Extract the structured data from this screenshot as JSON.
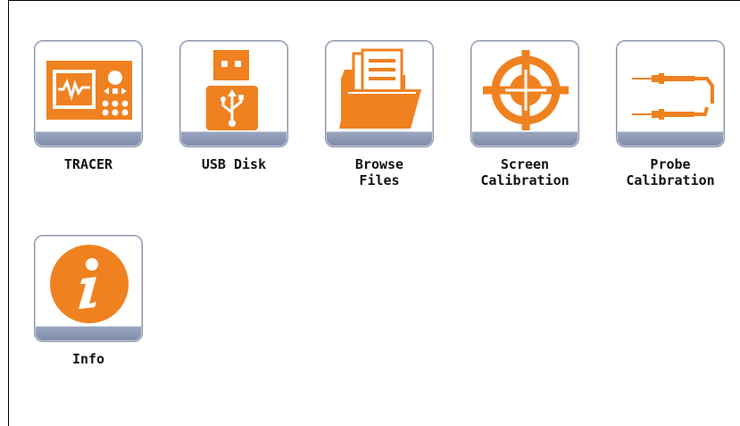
{
  "apps": [
    {
      "id": "tracer",
      "label": "TRACER",
      "icon": "tracer-instrument-icon"
    },
    {
      "id": "usb-disk",
      "label": "USB Disk",
      "icon": "usb-drive-icon"
    },
    {
      "id": "browse-files",
      "label": "Browse\nFiles",
      "icon": "folder-files-icon"
    },
    {
      "id": "screen-calibration",
      "label": "Screen\nCalibration",
      "icon": "crosshair-target-icon"
    },
    {
      "id": "probe-calibration",
      "label": "Probe\nCalibration",
      "icon": "probe-leads-icon"
    },
    {
      "id": "info",
      "label": "Info",
      "icon": "info-icon"
    }
  ],
  "colors": {
    "accent": "#f08120",
    "tile_border": "#8a93a8",
    "tile_base": "#8894b2"
  }
}
